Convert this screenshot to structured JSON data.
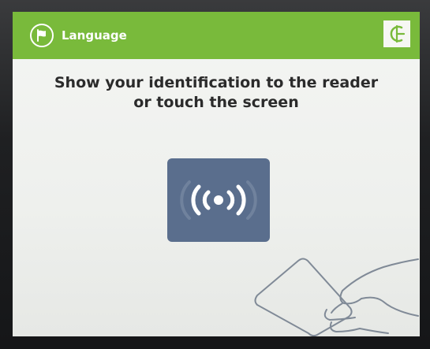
{
  "header": {
    "language_label": "Language",
    "bar_color": "#79ba3b",
    "language_icon": "flag-icon",
    "logo_icon": "brand-logo-icon"
  },
  "main": {
    "instruction_line1": "Show your identification to the reader",
    "instruction_line2": "or touch the screen",
    "reader_icon": "contactless-signal-icon",
    "reader_color": "#5a6e8d",
    "illustration_icon": "hand-holding-card-icon"
  }
}
